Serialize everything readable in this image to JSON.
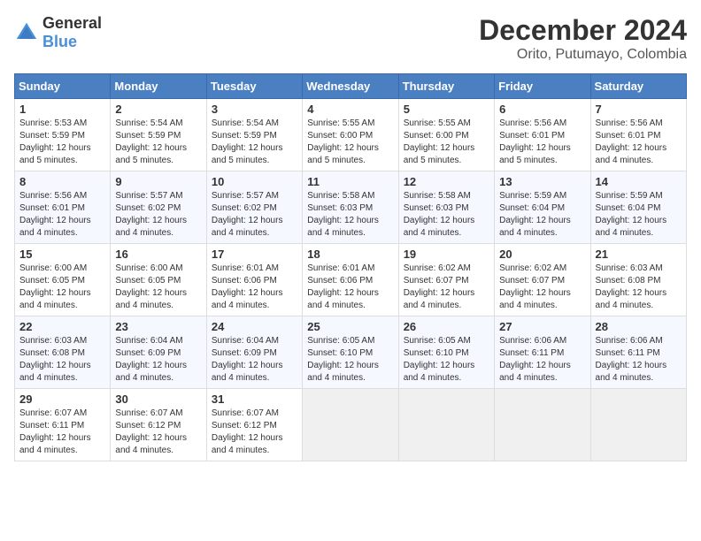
{
  "logo": {
    "text_general": "General",
    "text_blue": "Blue"
  },
  "header": {
    "title": "December 2024",
    "subtitle": "Orito, Putumayo, Colombia"
  },
  "weekdays": [
    "Sunday",
    "Monday",
    "Tuesday",
    "Wednesday",
    "Thursday",
    "Friday",
    "Saturday"
  ],
  "weeks": [
    [
      {
        "day": "1",
        "sunrise": "5:53 AM",
        "sunset": "5:59 PM",
        "daylight": "12 hours and 5 minutes."
      },
      {
        "day": "2",
        "sunrise": "5:54 AM",
        "sunset": "5:59 PM",
        "daylight": "12 hours and 5 minutes."
      },
      {
        "day": "3",
        "sunrise": "5:54 AM",
        "sunset": "5:59 PM",
        "daylight": "12 hours and 5 minutes."
      },
      {
        "day": "4",
        "sunrise": "5:55 AM",
        "sunset": "6:00 PM",
        "daylight": "12 hours and 5 minutes."
      },
      {
        "day": "5",
        "sunrise": "5:55 AM",
        "sunset": "6:00 PM",
        "daylight": "12 hours and 5 minutes."
      },
      {
        "day": "6",
        "sunrise": "5:56 AM",
        "sunset": "6:01 PM",
        "daylight": "12 hours and 5 minutes."
      },
      {
        "day": "7",
        "sunrise": "5:56 AM",
        "sunset": "6:01 PM",
        "daylight": "12 hours and 4 minutes."
      }
    ],
    [
      {
        "day": "8",
        "sunrise": "5:56 AM",
        "sunset": "6:01 PM",
        "daylight": "12 hours and 4 minutes."
      },
      {
        "day": "9",
        "sunrise": "5:57 AM",
        "sunset": "6:02 PM",
        "daylight": "12 hours and 4 minutes."
      },
      {
        "day": "10",
        "sunrise": "5:57 AM",
        "sunset": "6:02 PM",
        "daylight": "12 hours and 4 minutes."
      },
      {
        "day": "11",
        "sunrise": "5:58 AM",
        "sunset": "6:03 PM",
        "daylight": "12 hours and 4 minutes."
      },
      {
        "day": "12",
        "sunrise": "5:58 AM",
        "sunset": "6:03 PM",
        "daylight": "12 hours and 4 minutes."
      },
      {
        "day": "13",
        "sunrise": "5:59 AM",
        "sunset": "6:04 PM",
        "daylight": "12 hours and 4 minutes."
      },
      {
        "day": "14",
        "sunrise": "5:59 AM",
        "sunset": "6:04 PM",
        "daylight": "12 hours and 4 minutes."
      }
    ],
    [
      {
        "day": "15",
        "sunrise": "6:00 AM",
        "sunset": "6:05 PM",
        "daylight": "12 hours and 4 minutes."
      },
      {
        "day": "16",
        "sunrise": "6:00 AM",
        "sunset": "6:05 PM",
        "daylight": "12 hours and 4 minutes."
      },
      {
        "day": "17",
        "sunrise": "6:01 AM",
        "sunset": "6:06 PM",
        "daylight": "12 hours and 4 minutes."
      },
      {
        "day": "18",
        "sunrise": "6:01 AM",
        "sunset": "6:06 PM",
        "daylight": "12 hours and 4 minutes."
      },
      {
        "day": "19",
        "sunrise": "6:02 AM",
        "sunset": "6:07 PM",
        "daylight": "12 hours and 4 minutes."
      },
      {
        "day": "20",
        "sunrise": "6:02 AM",
        "sunset": "6:07 PM",
        "daylight": "12 hours and 4 minutes."
      },
      {
        "day": "21",
        "sunrise": "6:03 AM",
        "sunset": "6:08 PM",
        "daylight": "12 hours and 4 minutes."
      }
    ],
    [
      {
        "day": "22",
        "sunrise": "6:03 AM",
        "sunset": "6:08 PM",
        "daylight": "12 hours and 4 minutes."
      },
      {
        "day": "23",
        "sunrise": "6:04 AM",
        "sunset": "6:09 PM",
        "daylight": "12 hours and 4 minutes."
      },
      {
        "day": "24",
        "sunrise": "6:04 AM",
        "sunset": "6:09 PM",
        "daylight": "12 hours and 4 minutes."
      },
      {
        "day": "25",
        "sunrise": "6:05 AM",
        "sunset": "6:10 PM",
        "daylight": "12 hours and 4 minutes."
      },
      {
        "day": "26",
        "sunrise": "6:05 AM",
        "sunset": "6:10 PM",
        "daylight": "12 hours and 4 minutes."
      },
      {
        "day": "27",
        "sunrise": "6:06 AM",
        "sunset": "6:11 PM",
        "daylight": "12 hours and 4 minutes."
      },
      {
        "day": "28",
        "sunrise": "6:06 AM",
        "sunset": "6:11 PM",
        "daylight": "12 hours and 4 minutes."
      }
    ],
    [
      {
        "day": "29",
        "sunrise": "6:07 AM",
        "sunset": "6:11 PM",
        "daylight": "12 hours and 4 minutes."
      },
      {
        "day": "30",
        "sunrise": "6:07 AM",
        "sunset": "6:12 PM",
        "daylight": "12 hours and 4 minutes."
      },
      {
        "day": "31",
        "sunrise": "6:07 AM",
        "sunset": "6:12 PM",
        "daylight": "12 hours and 4 minutes."
      },
      null,
      null,
      null,
      null
    ]
  ]
}
